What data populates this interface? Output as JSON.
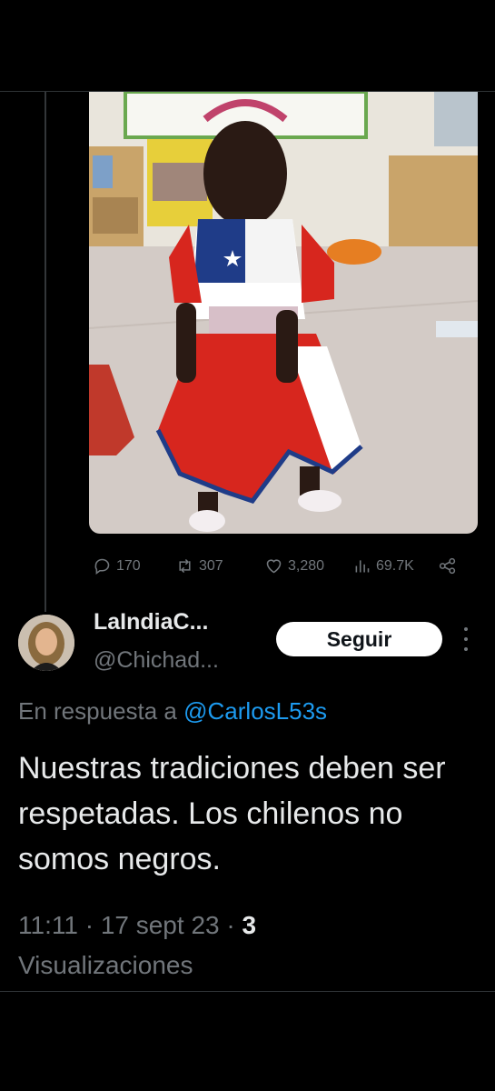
{
  "tweet_actions": {
    "replies": "170",
    "retweets": "307",
    "likes": "3,280",
    "views": "69.7K"
  },
  "reply_tweet": {
    "display_name": "LaIndiaC...",
    "handle": "@Chichad...",
    "follow_label": "Seguir",
    "reply_prefix": "En respuesta a",
    "reply_to": "@CarlosL53s",
    "text": "Nuestras tradiciones deben ser respetadas. Los chilenos no somos negros.",
    "time": "11:11",
    "date": "17 sept 23",
    "views_count": "3",
    "views_label": "Visualizaciones"
  },
  "colors": {
    "background": "#000000",
    "text": "#e7e9ea",
    "muted": "#71767b",
    "link": "#1d9bf0"
  }
}
